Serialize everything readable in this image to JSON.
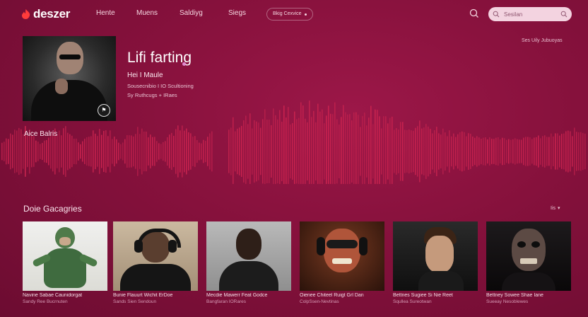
{
  "app": {
    "logo_text": "deszer"
  },
  "nav": {
    "items": [
      {
        "label": "Hente"
      },
      {
        "label": "Muens"
      },
      {
        "label": "Saldiyg"
      },
      {
        "label": "Siegs"
      }
    ],
    "device_label": "Bkig Cexvice"
  },
  "search": {
    "placeholder": "Sesilan"
  },
  "top_right_link": "Ses Uily Jubuoyas",
  "hero": {
    "title": "Lifi farting",
    "artist": "Hei I Maule",
    "meta_line_1": "Sousecnibio I IO Scultioning",
    "meta_line_2": "Sy Ruthcugs + IRaes",
    "now_label": "Aice Balris"
  },
  "section": {
    "title": "Doie Gacagries",
    "control_label": "Iis",
    "cards": [
      {
        "title": "Navine Sabae Caunidorgat",
        "subtitle": "Sandy Ree Bucrnuten"
      },
      {
        "title": "Bunie Flauurt Wichit ErDoe",
        "subtitle": "Sands Sien Sendoun"
      },
      {
        "title": "Mecdie Mawerr Feat Godce",
        "subtitle": "Bangfaran IORares"
      },
      {
        "title": "Oienee Chiteel Ruigt Grl Dan",
        "subtitle": "ColpSsen-Nevtinas"
      },
      {
        "title": "Bettnes Sugiee Si Nie Reet",
        "subtitle": "Squllea Sureotwan"
      },
      {
        "title": "Bettney Sowee Shae Iane",
        "subtitle": "Sueeay Nesoblewes"
      }
    ]
  },
  "colors": {
    "background": "#86113c",
    "waveform": "#c8234f",
    "search_bg": "#f3d3e0"
  }
}
